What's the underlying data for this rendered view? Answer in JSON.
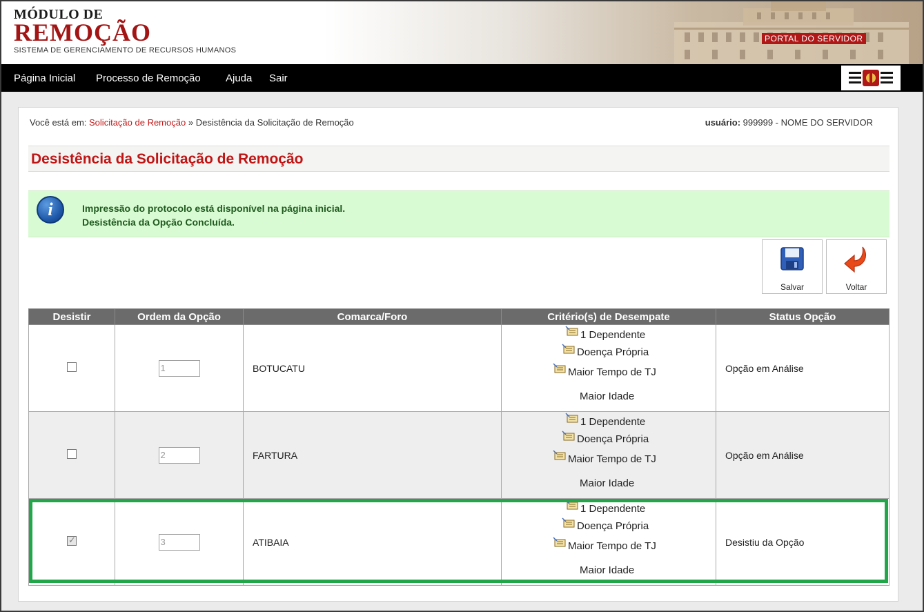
{
  "header": {
    "logo_line1": "MÓDULO DE",
    "logo_line2": "REMOÇÃO",
    "logo_subtitle": "SISTEMA DE GERENCIAMENTO DE RECURSOS HUMANOS",
    "portal_badge": "PORTAL DO SERVIDOR"
  },
  "nav": {
    "items": [
      {
        "label": "Página Inicial"
      },
      {
        "label": "Processo de Remoção"
      },
      {
        "label": "Ajuda"
      },
      {
        "label": "Sair"
      }
    ]
  },
  "breadcrumb": {
    "prefix": "Você está em:",
    "link": "Solicitação de Remoção",
    "separator": "»",
    "current": "Desistência da Solicitação de Remoção"
  },
  "user": {
    "label": "usuário:",
    "value": "999999 - NOME DO SERVIDOR"
  },
  "page_title": "Desistência da Solicitação de Remoção",
  "message": {
    "line1": "Impressão do protocolo está disponível na página inicial.",
    "line2": "Desistência da Opção Concluída."
  },
  "toolbar": {
    "save_label": "Salvar",
    "back_label": "Voltar"
  },
  "table": {
    "headers": [
      "Desistir",
      "Ordem da Opção",
      "Comarca/Foro",
      "Critério(s) de Desempate",
      "Status Opção"
    ],
    "rows": [
      {
        "checked": false,
        "order": "1",
        "comarca": "BOTUCATU",
        "criteria": [
          "1 Dependente",
          "Doença Própria",
          "Maior Tempo de TJ",
          "Maior Idade"
        ],
        "status": "Opção em Análise"
      },
      {
        "checked": false,
        "order": "2",
        "comarca": "FARTURA",
        "criteria": [
          "1 Dependente",
          "Doença Própria",
          "Maior Tempo de TJ",
          "Maior Idade"
        ],
        "status": "Opção em Análise"
      },
      {
        "checked": true,
        "order": "3",
        "comarca": "ATIBAIA",
        "criteria": [
          "1 Dependente",
          "Doença Própria",
          "Maior Tempo de TJ",
          "Maior Idade"
        ],
        "status": "Desistiu da Opção"
      }
    ]
  },
  "colors": {
    "brand_red": "#c01515",
    "nav_bg": "#000000",
    "message_bg": "#d9fbd3",
    "highlight_green": "#22a64a",
    "table_header_bg": "#6b6b6b"
  }
}
